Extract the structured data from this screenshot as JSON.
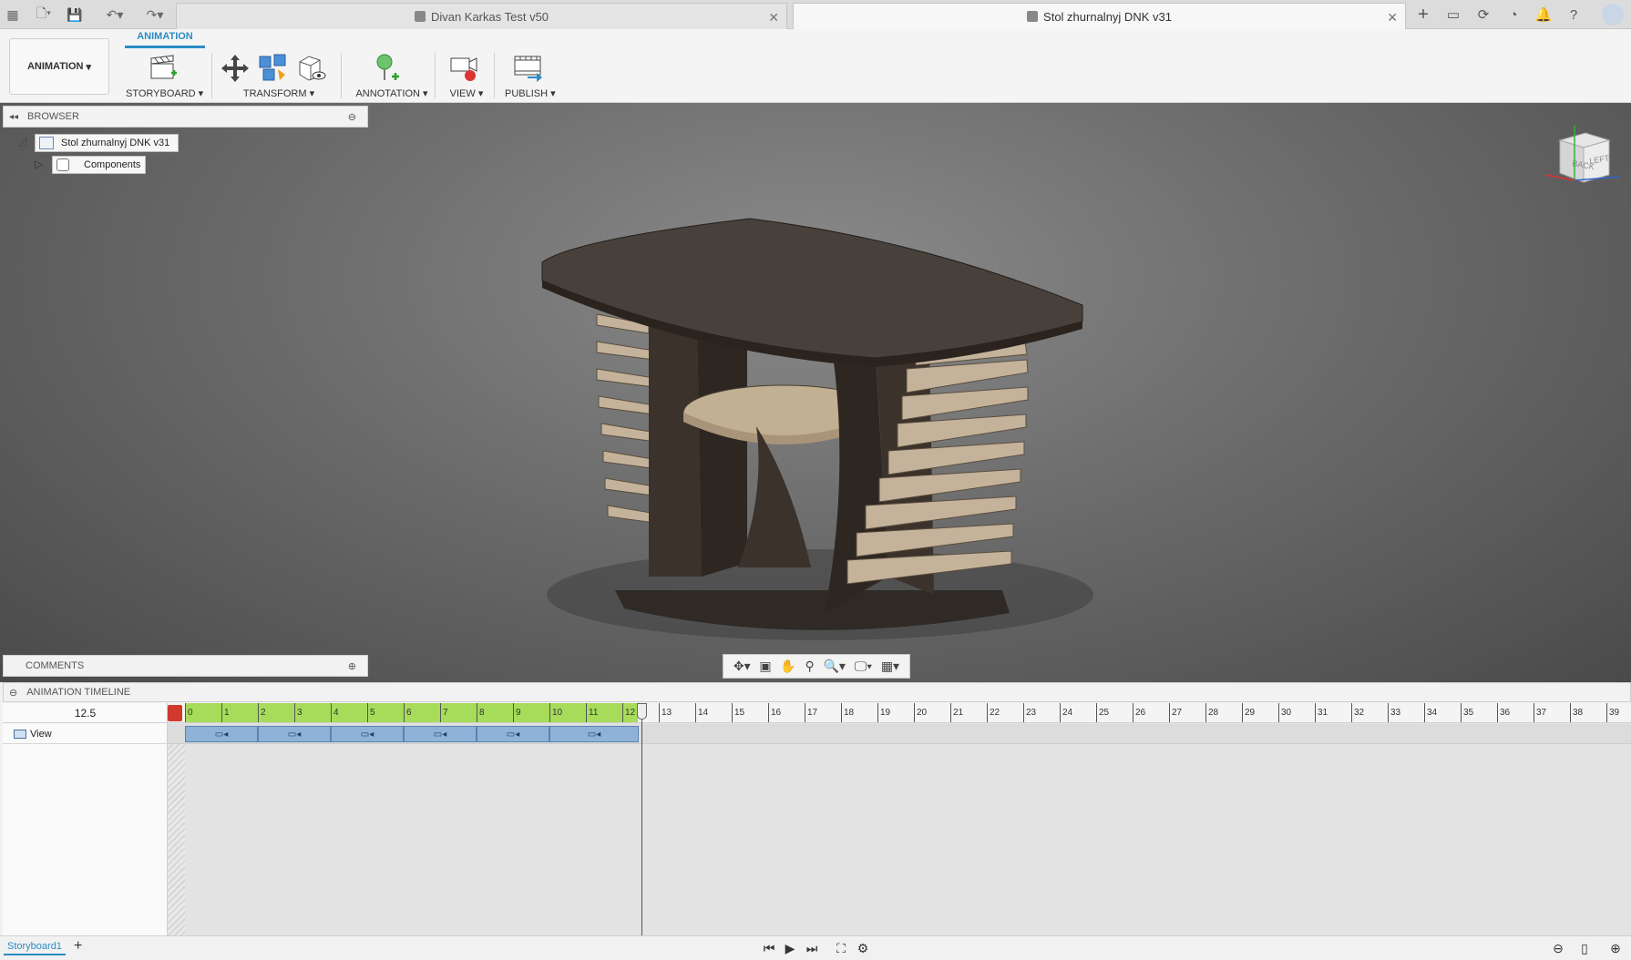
{
  "tabs": [
    {
      "title": "Divan Karkas Test v50",
      "active": false
    },
    {
      "title": "Stol zhurnalnyj DNK v31",
      "active": true
    }
  ],
  "toolbar": {
    "workspace_label": "ANIMATION",
    "workspace_tab": "ANIMATION",
    "groups": {
      "storyboard": "STORYBOARD",
      "transform": "TRANSFORM",
      "annotation": "ANNOTATION",
      "view": "VIEW",
      "publish": "PUBLISH"
    }
  },
  "browser": {
    "title": "BROWSER",
    "root": "Stol zhurnalnyj DNK v31",
    "child": "Components"
  },
  "comments": {
    "title": "COMMENTS"
  },
  "viewcube": {
    "face_left": "LEFT",
    "face_back": "BACK"
  },
  "timeline": {
    "title": "ANIMATION TIMELINE",
    "current_time": "12.5",
    "track_label": "View",
    "ticks": [
      "0",
      "1",
      "2",
      "3",
      "4",
      "5",
      "6",
      "7",
      "8",
      "9",
      "10",
      "11",
      "12",
      "13",
      "14",
      "15",
      "16",
      "17",
      "18",
      "19",
      "20",
      "21",
      "22",
      "23",
      "24",
      "25",
      "26",
      "27",
      "28",
      "29",
      "30",
      "31",
      "32",
      "33",
      "34",
      "35",
      "36",
      "37",
      "38",
      "39"
    ],
    "clip_count": 6
  },
  "storyboard_tab": "Storyboard1",
  "colors": {
    "accent": "#2b8cc4",
    "ruler_active": "#a6dc5a",
    "clip": "#8fb2d8"
  }
}
